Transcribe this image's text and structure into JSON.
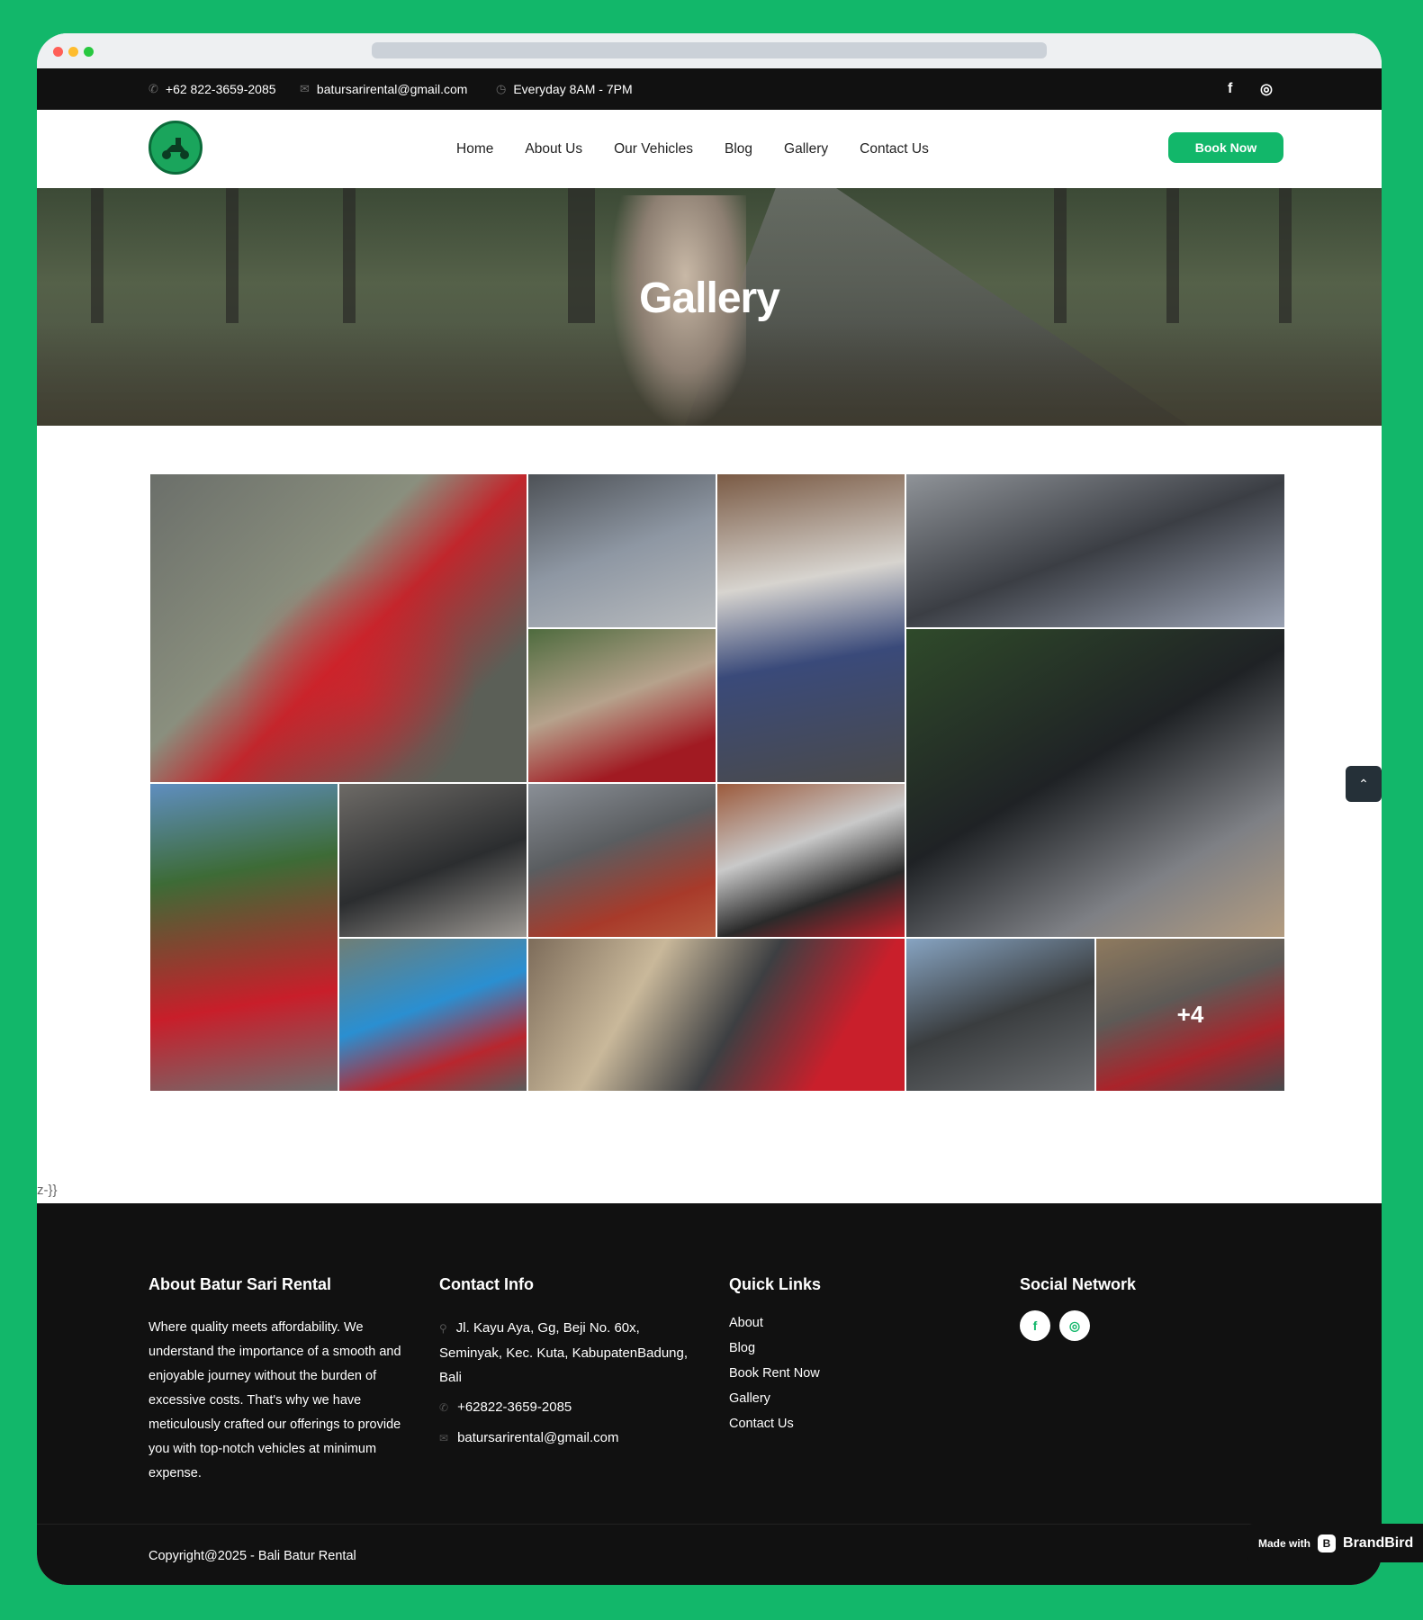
{
  "topbar": {
    "phone": "+62 822-3659-2085",
    "email": "batursarirental@gmail.com",
    "hours": "Everyday 8AM - 7PM",
    "facebook_glyph": "f",
    "instagram_glyph": "◎"
  },
  "nav": {
    "items": [
      "Home",
      "About Us",
      "Our Vehicles",
      "Blog",
      "Gallery",
      "Contact Us"
    ],
    "book_label": "Book Now"
  },
  "hero": {
    "title": "Gallery"
  },
  "gallery": {
    "more_label": "+4"
  },
  "stray_text": "z-}}",
  "footer": {
    "about_title": "About Batur Sari Rental",
    "about_text": "Where quality meets affordability. We understand the importance of a smooth and enjoyable journey without the burden of excessive costs. That's why we have meticulously crafted our offerings to provide you with top-notch vehicles at minimum expense.",
    "contact_title": "Contact Info",
    "address": "Jl. Kayu Aya, Gg, Beji No. 60x, Seminyak, Kec. Kuta, KabupatenBadung, Bali",
    "phone": "+62822-3659-2085",
    "email": "batursarirental@gmail.com",
    "links_title": "Quick Links",
    "links": [
      "About",
      "Blog",
      "Book Rent Now",
      "Gallery",
      "Contact Us"
    ],
    "social_title": "Social Network",
    "copyright": "Copyright@2025 - Bali Batur Rental"
  },
  "badge": {
    "made_with": "Made with",
    "brand": "BrandBird"
  },
  "colors": {
    "accent": "#12b76a",
    "dark": "#111111"
  }
}
